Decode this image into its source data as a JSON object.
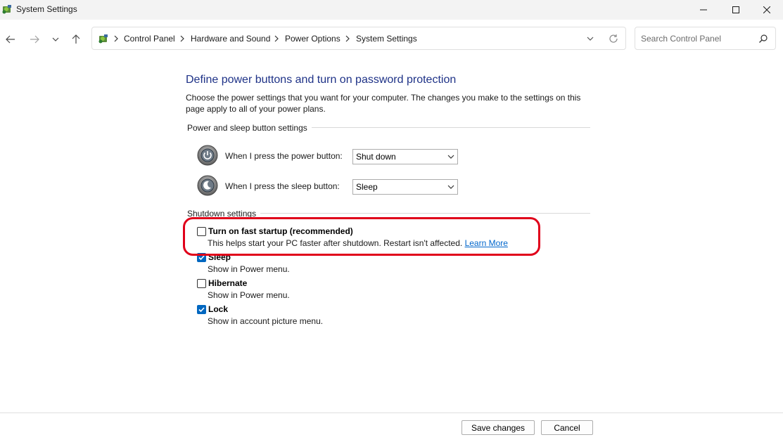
{
  "window": {
    "title": "System Settings",
    "controls": {
      "minimize": "minimize-icon",
      "maximize": "maximize-icon",
      "close": "close-icon"
    }
  },
  "nav": {
    "back_icon": "arrow-left-icon",
    "forward_icon": "arrow-right-icon",
    "recent_icon": "chevron-down-icon",
    "up_icon": "arrow-up-icon"
  },
  "address": {
    "icon": "control-panel-icon",
    "breadcrumbs": [
      "Control Panel",
      "Hardware and Sound",
      "Power Options",
      "System Settings"
    ]
  },
  "search": {
    "placeholder": "Search Control Panel",
    "value": ""
  },
  "page": {
    "heading": "Define power buttons and turn on password protection",
    "intro": "Choose the power settings that you want for your computer. The changes you make to the settings on this page apply to all of your power plans."
  },
  "power_group": {
    "label": "Power and sleep button settings",
    "rows": [
      {
        "label": "When I press the power button:",
        "value": "Shut down",
        "icon": "power-button-icon"
      },
      {
        "label": "When I press the sleep button:",
        "value": "Sleep",
        "icon": "sleep-button-icon"
      }
    ]
  },
  "shutdown_group": {
    "label": "Shutdown settings",
    "options": [
      {
        "title": "Turn on fast startup (recommended)",
        "desc": "This helps start your PC faster after shutdown. Restart isn't affected.",
        "link": "Learn More",
        "checked": false
      },
      {
        "title": "Sleep",
        "desc": "Show in Power menu.",
        "checked": true
      },
      {
        "title": "Hibernate",
        "desc": "Show in Power menu.",
        "checked": false
      },
      {
        "title": "Lock",
        "desc": "Show in account picture menu.",
        "checked": true
      }
    ]
  },
  "footer": {
    "save_label": "Save changes",
    "cancel_label": "Cancel"
  },
  "colors": {
    "heading": "#1e3287",
    "link": "#0066cc",
    "checkbox_accent": "#0067c0",
    "highlight": "#e0001a"
  }
}
